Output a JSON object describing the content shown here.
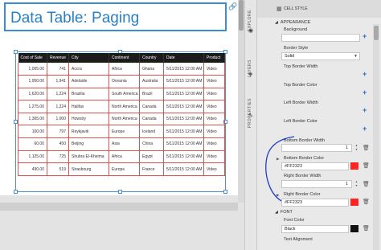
{
  "canvas": {
    "title": "Data Table: Paging",
    "table": {
      "columns": [
        "Cost of Sale",
        "Revenue",
        "City",
        "Continent",
        "Country",
        "Date",
        "Product"
      ],
      "rows": [
        [
          "1,005.00",
          "741",
          "Accra",
          "Africa",
          "Ghana",
          "5/11/2015 12:00 AM",
          "Video"
        ],
        [
          "1,950.00",
          "1,941",
          "Adelaide",
          "Oceania",
          "Australia",
          "5/11/2015 12:00 AM",
          "Video"
        ],
        [
          "1,620.00",
          "1,224",
          "Brasilia",
          "South America",
          "Brazil",
          "5/11/2015 12:00 AM",
          "Video"
        ],
        [
          "1,275.00",
          "1,224",
          "Halifax",
          "North America",
          "Canada",
          "5/11/2015 12:00 AM",
          "Video"
        ],
        [
          "1,365.00",
          "1,000",
          "Howstry",
          "North America",
          "Canada",
          "5/11/2015 12:00 AM",
          "Video"
        ],
        [
          "100.00",
          "797",
          "Reykjavik",
          "Europe",
          "Iceland",
          "5/11/2015 12:00 AM",
          "Video"
        ],
        [
          "60.00",
          "450",
          "Beijing",
          "Asia",
          "China",
          "5/11/2015 12:00 AM",
          "Video"
        ],
        [
          "1,125.00",
          "725",
          "Shubra El-Kheima",
          "Africa",
          "Egypt",
          "5/11/2015 12:00 AM",
          "Video"
        ],
        [
          "490.00",
          "519",
          "Strasbourg",
          "Europe",
          "France",
          "5/11/2015 12:00 AM",
          "Video"
        ]
      ]
    }
  },
  "vtabs": {
    "explore": "EXPLORE",
    "layers": "LAYERS",
    "properties": "PROPERTIES"
  },
  "panel": {
    "header": "CELL STYLE",
    "appearance": "APPEARANCE",
    "background_label": "Background",
    "border_style_label": "Border Style",
    "border_style_value": "Solid",
    "top_border_width_label": "Top Border Width",
    "top_border_color_label": "Top Border Color",
    "left_border_width_label": "Left Border Width",
    "left_border_color_label": "Left Border Color",
    "bottom_border_width_label": "Bottom Border Width",
    "bottom_border_width_value": "1",
    "bottom_border_color_label": "Bottom Border Color",
    "bottom_border_color_value": "#FF2323",
    "right_border_width_label": "Right Border Width",
    "right_border_width_value": "1",
    "right_border_color_label": "Right Border Color",
    "right_border_color_value": "#FF2323",
    "font": "FONT",
    "font_color_label": "Font Color",
    "font_color_value": "Black",
    "text_alignment_label": "Text Alignment"
  },
  "colors": {
    "accent": "#2b7fc3",
    "border_red": "#FF2323",
    "swatch_black": "#111111"
  }
}
